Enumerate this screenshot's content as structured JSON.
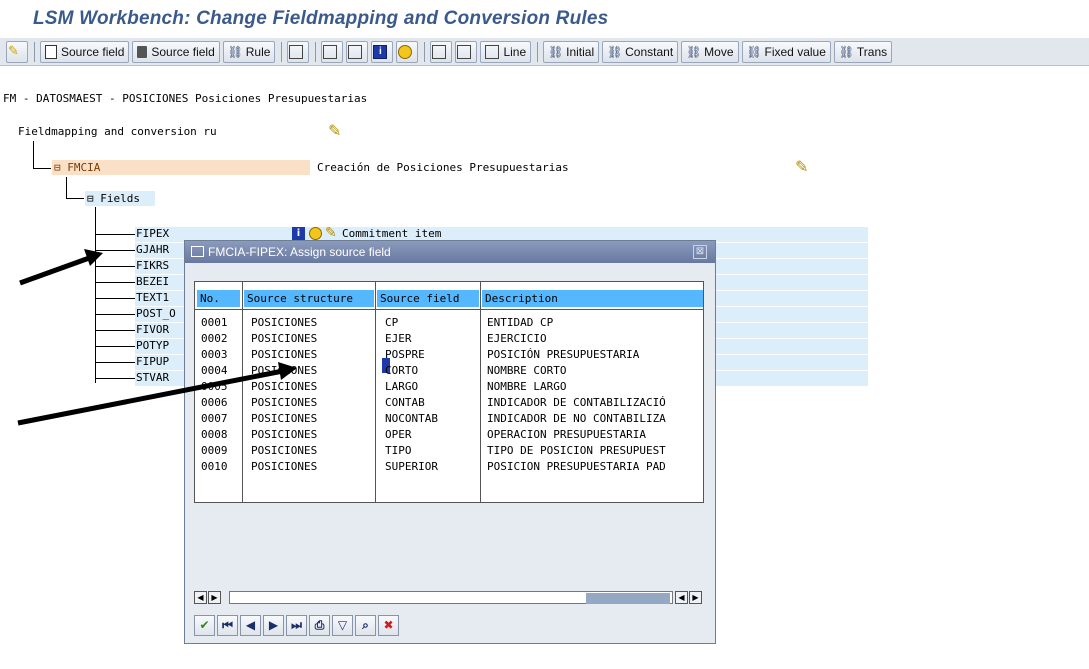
{
  "window": {
    "title": "LSM Workbench: Change Fieldmapping and Conversion Rules"
  },
  "toolbar": {
    "buttons": [
      {
        "label": "Source field",
        "icon": "create-icon"
      },
      {
        "label": "Source field",
        "icon": "trash-icon"
      },
      {
        "label": "Rule",
        "icon": "rule-icon"
      },
      {
        "label": "Line",
        "icon": "line-icon"
      },
      {
        "label": "Initial",
        "icon": "rule-icon"
      },
      {
        "label": "Constant",
        "icon": "rule-icon"
      },
      {
        "label": "Move",
        "icon": "rule-icon"
      },
      {
        "label": "Fixed value",
        "icon": "rule-icon"
      },
      {
        "label": "Trans",
        "icon": "rule-icon"
      }
    ]
  },
  "breadcrumb": "FM - DATOSMAEST - POSICIONES Posiciones Presupuestarias",
  "tree": {
    "root_label": "Fieldmapping and conversion ru",
    "structure_name": "FMCIA",
    "structure_desc": "Creación de Posiciones Presupuestarias",
    "fields_label": "Fields",
    "fields": [
      "FIPEX",
      "GJAHR",
      "FIKRS",
      "BEZEI",
      "TEXT1",
      "POST_O",
      "FIVOR",
      "POTYP",
      "FIPUP",
      "STVAR"
    ],
    "first_field_desc": "Commitment item"
  },
  "dialog": {
    "title": "FMCIA-FIPEX: Assign source field",
    "columns": [
      "No.",
      "Source structure",
      "Source field",
      "Description"
    ],
    "rows": [
      [
        "0001",
        "POSICIONES",
        "CP",
        "ENTIDAD CP"
      ],
      [
        "0002",
        "POSICIONES",
        "EJER",
        "EJERCICIO"
      ],
      [
        "0003",
        "POSICIONES",
        "POSPRE",
        "POSICIÓN PRESUPUESTARIA"
      ],
      [
        "0004",
        "POSICIONES",
        "CORTO",
        "NOMBRE CORTO"
      ],
      [
        "0005",
        "POSICIONES",
        "LARGO",
        "NOMBRE LARGO"
      ],
      [
        "0006",
        "POSICIONES",
        "CONTAB",
        "INDICADOR DE CONTABILIZACIÓ"
      ],
      [
        "0007",
        "POSICIONES",
        "NOCONTAB",
        "INDICADOR DE NO CONTABILIZA"
      ],
      [
        "0008",
        "POSICIONES",
        "OPER",
        "OPERACION PRESUPUESTARIA"
      ],
      [
        "0009",
        "POSICIONES",
        "TIPO",
        "TIPO DE POSICION PRESUPUEST"
      ],
      [
        "0010",
        "POSICIONES",
        "SUPERIOR",
        "POSICION PRESUPUESTARIA PAD"
      ]
    ],
    "selected_row": 2
  },
  "colors": {
    "title": "#3b5a8c",
    "header_blue": "#55b8ff",
    "row_highlight": "#dbeefa",
    "node_highlight": "#fbe0c8"
  }
}
